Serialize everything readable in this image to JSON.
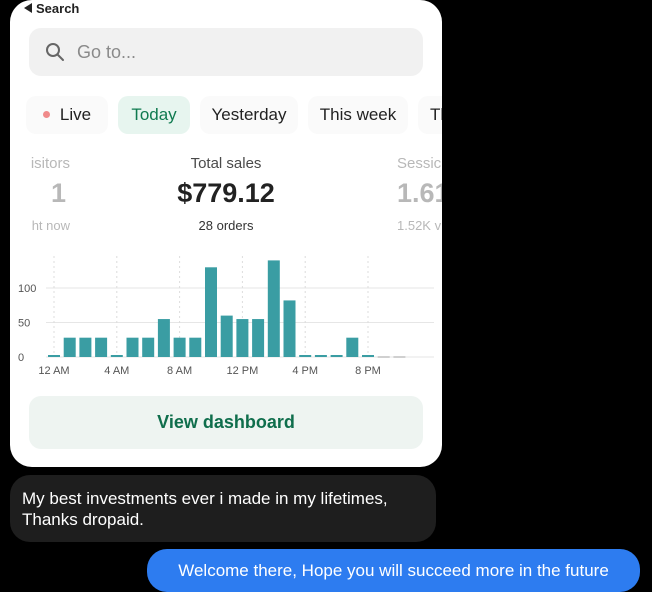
{
  "nav": {
    "back_label": "Search"
  },
  "search": {
    "placeholder": "Go to..."
  },
  "tabs": [
    {
      "label": "Live"
    },
    {
      "label": "Today",
      "active": true
    },
    {
      "label": "Yesterday"
    },
    {
      "label": "This week"
    },
    {
      "label": "Thi"
    }
  ],
  "stats": {
    "visitors": {
      "label": "isitors",
      "value": "1",
      "sub": "ht now"
    },
    "total_sales": {
      "label": "Total sales",
      "value": "$779.12",
      "sub": "28 orders"
    },
    "sessions": {
      "label": "Sessic",
      "value": "1.61",
      "sub": "1.52K v"
    }
  },
  "chart_data": {
    "type": "bar",
    "yticks": [
      "100",
      "50",
      "0"
    ],
    "ylim": [
      0,
      150
    ],
    "x_tick_labels": [
      "12 AM",
      "4 AM",
      "8 AM",
      "12 PM",
      "4 PM",
      "8 PM"
    ],
    "values": [
      2,
      28,
      28,
      28,
      2,
      28,
      28,
      55,
      28,
      28,
      130,
      60,
      55,
      55,
      140,
      82,
      2,
      2,
      2,
      28,
      2,
      0,
      0
    ],
    "bar_color": "#3a9da3",
    "grid": true
  },
  "actions": {
    "view_dashboard": "View dashboard"
  },
  "messages": [
    {
      "direction": "incoming",
      "text": "My best investments ever i made in my lifetimes, Thanks dropaid."
    },
    {
      "direction": "outgoing",
      "text": "Welcome there, Hope you will succeed more in the future"
    }
  ],
  "colors": {
    "accent": "#0f7a4f",
    "bubble_out": "#2d7cf0",
    "bubble_in": "#1e1e1e"
  }
}
